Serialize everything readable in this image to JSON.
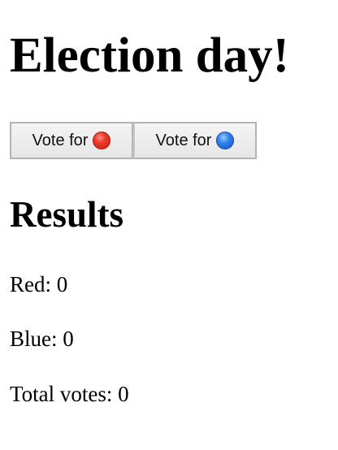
{
  "page": {
    "heading": "Election day!",
    "results_heading": "Results"
  },
  "buttons": {
    "vote_red": {
      "label": "Vote for",
      "icon": "red-circle-icon",
      "color": "#e0281c"
    },
    "vote_blue": {
      "label": "Vote for",
      "icon": "blue-circle-icon",
      "color": "#1f6fde"
    }
  },
  "results": {
    "red": "Red: 0",
    "blue": "Blue: 0",
    "total": "Total votes: 0"
  }
}
